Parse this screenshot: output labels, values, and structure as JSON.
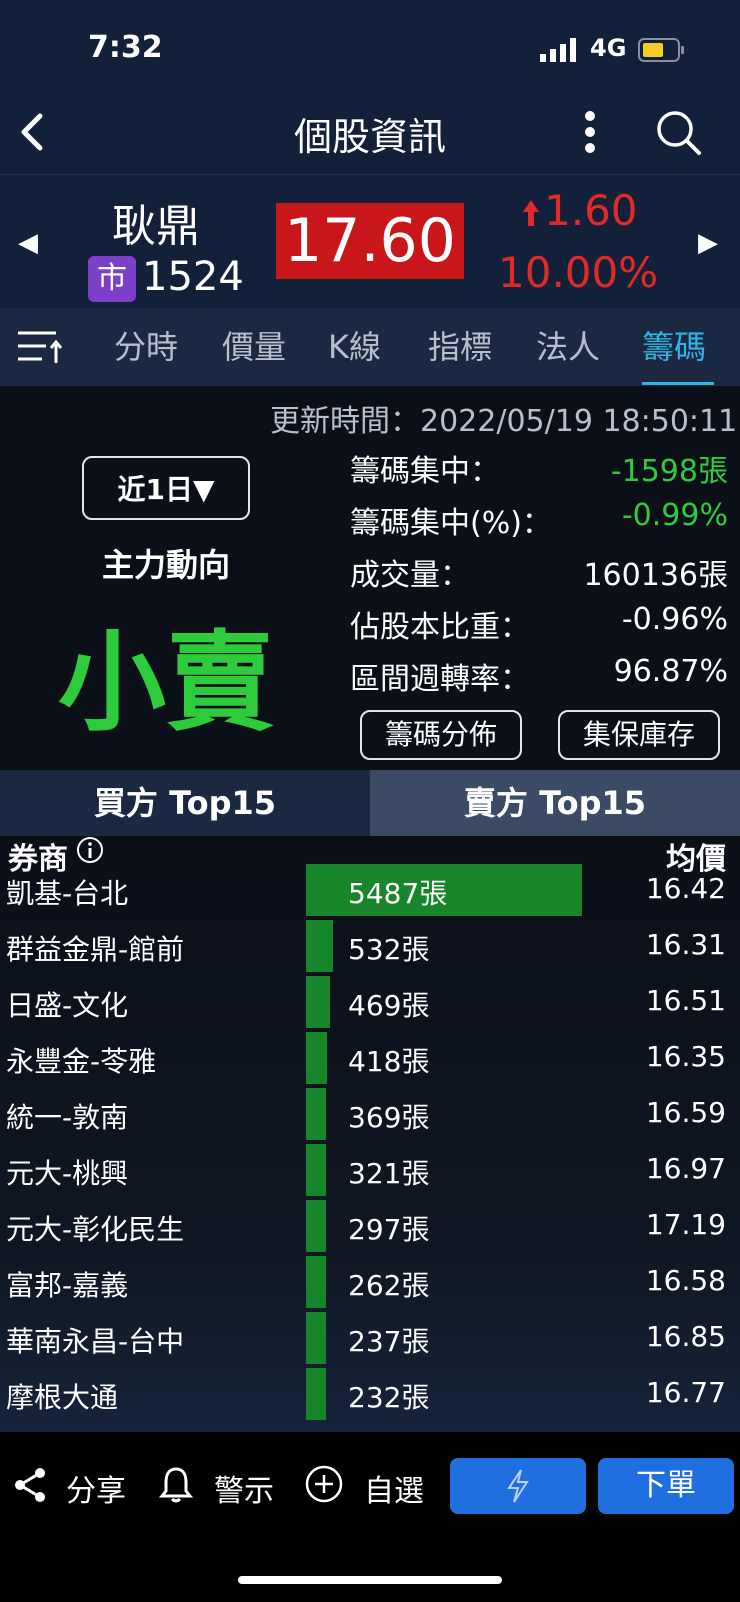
{
  "status_bar": {
    "time": "7:32",
    "network": "4G"
  },
  "nav": {
    "title": "個股資訊"
  },
  "stock": {
    "name": "耿鼎",
    "market_badge": "市",
    "code": "1524",
    "price": "17.60",
    "change": "1.60",
    "change_pct": "10.00%",
    "colors": {
      "up": "#e02a27",
      "price_bg": "#c9161b",
      "market_badge": "#7b3fc9"
    }
  },
  "tabs": [
    "分時",
    "價量",
    "K線",
    "指標",
    "法人",
    "籌碼"
  ],
  "active_tab": "籌碼",
  "info": {
    "updated": "更新時間：2022/05/19 18:50:11",
    "period_button": "近1日▼",
    "main_force_label": "主力動向",
    "main_force_signal": "小賣",
    "stats": [
      {
        "label": "籌碼集中：",
        "value": "-1598張"
      },
      {
        "label": "籌碼集中(%)：",
        "value": "-0.99%"
      },
      {
        "label": "成交量：",
        "value": "160136張"
      },
      {
        "label": "佔股本比重：",
        "value": "-0.96%"
      },
      {
        "label": "區間週轉率：",
        "value": "96.87%"
      }
    ],
    "buttons": [
      "籌碼分佈",
      "集保庫存"
    ]
  },
  "side_tabs": {
    "buy": "買方 Top15",
    "sell": "賣方 Top15",
    "active": "buy"
  },
  "table": {
    "headers": {
      "broker": "券商",
      "avg": "均價"
    },
    "rows": [
      {
        "broker": "凱基-台北",
        "volume": "5487張",
        "volume_num": 5487,
        "avg": "16.42"
      },
      {
        "broker": "群益金鼎-館前",
        "volume": "532張",
        "volume_num": 532,
        "avg": "16.31"
      },
      {
        "broker": "日盛-文化",
        "volume": "469張",
        "volume_num": 469,
        "avg": "16.51"
      },
      {
        "broker": "永豐金-苓雅",
        "volume": "418張",
        "volume_num": 418,
        "avg": "16.35"
      },
      {
        "broker": "統一-敦南",
        "volume": "369張",
        "volume_num": 369,
        "avg": "16.59"
      },
      {
        "broker": "元大-桃興",
        "volume": "321張",
        "volume_num": 321,
        "avg": "16.97"
      },
      {
        "broker": "元大-彰化民生",
        "volume": "297張",
        "volume_num": 297,
        "avg": "17.19"
      },
      {
        "broker": "富邦-嘉義",
        "volume": "262張",
        "volume_num": 262,
        "avg": "16.58"
      },
      {
        "broker": "華南永昌-台中",
        "volume": "237張",
        "volume_num": 237,
        "avg": "16.85"
      },
      {
        "broker": "摩根大通",
        "volume": "232張",
        "volume_num": 232,
        "avg": "16.77"
      }
    ]
  },
  "bottom_bar": {
    "share": "分享",
    "alert": "警示",
    "watchlist": "自選",
    "order": "下單"
  }
}
